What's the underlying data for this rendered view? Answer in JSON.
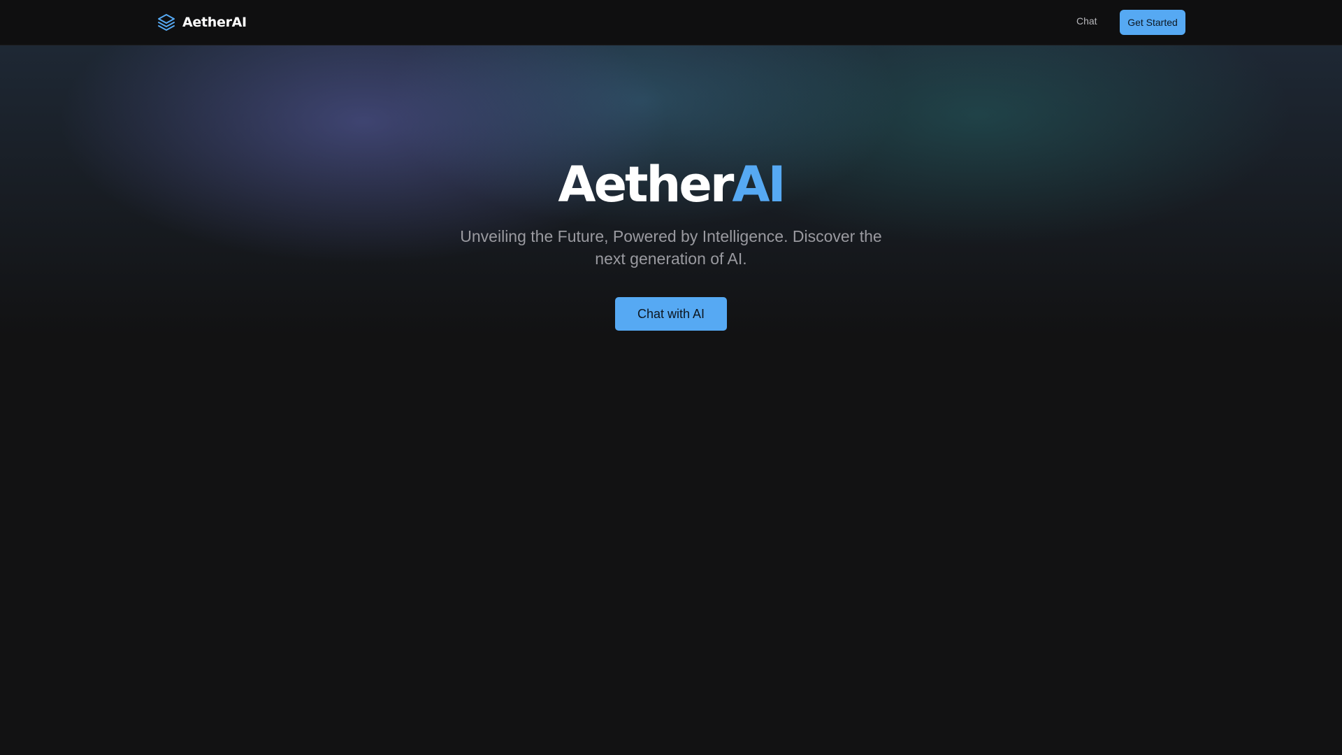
{
  "header": {
    "brand_name": "AetherAI",
    "logo_icon": "layers-icon",
    "nav_chat_label": "Chat",
    "cta_label": "Get Started"
  },
  "hero": {
    "title_main": "Aether",
    "title_accent": "AI",
    "subtitle": "Unveiling the Future, Powered by Intelligence. Discover the next generation of AI.",
    "cta_label": "Chat with AI"
  },
  "colors": {
    "accent": "#56a9f3",
    "background": "#121213",
    "header_background": "#0f0f10",
    "subtitle_text": "#9a9aa0"
  }
}
